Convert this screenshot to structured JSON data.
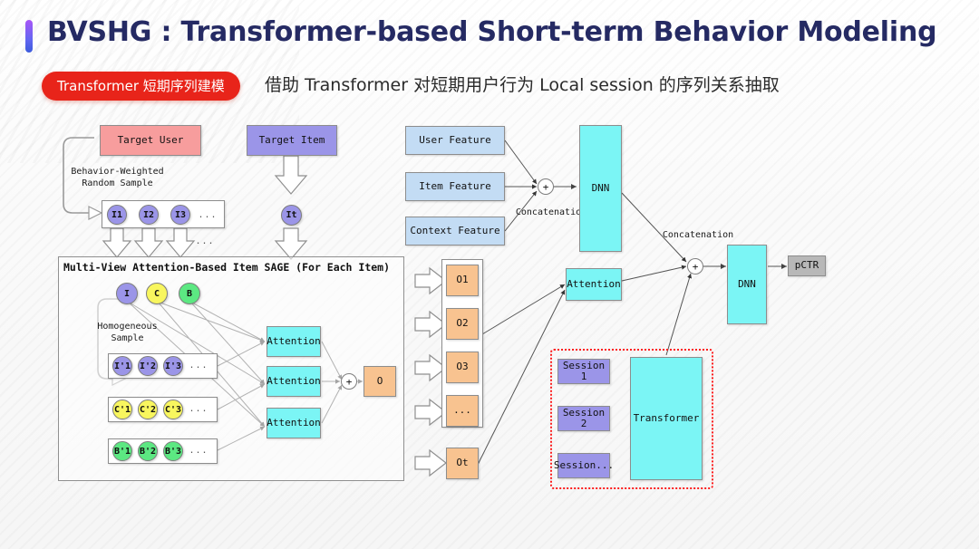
{
  "header": {
    "title": "BVSHG : Transformer-based Short-term Behavior Modeling",
    "badge": "Transformer 短期序列建模",
    "subtitle": "借助 Transformer 对短期用户行为 Local session 的序列关系抽取",
    "accent_bar_color": "#6366f1",
    "badge_color": "#e8241a",
    "title_color": "#252a63"
  },
  "diagram": {
    "target_user": "Target User",
    "target_item": "Target Item",
    "behavior_sample_label": "Behavior-Weighted\nRandom Sample",
    "homogeneous_sample_label": "Homogeneous\nSample",
    "item_seq": [
      "I1",
      "I2",
      "I3"
    ],
    "item_seq_ellipsis": "...",
    "target_item_node": "It",
    "sage_panel_title": "Multi-View Attention-Based Item SAGE (For Each Item)",
    "view_nodes": [
      {
        "label": "I",
        "color": "#9b95e8"
      },
      {
        "label": "C",
        "color": "#f8f65e"
      },
      {
        "label": "B",
        "color": "#5ce882"
      }
    ],
    "neighbor_rows": [
      {
        "nodes": [
          "I'1",
          "I'2",
          "I'3"
        ],
        "ellipsis": "...",
        "color": "#9b95e8"
      },
      {
        "nodes": [
          "C'1",
          "C'2",
          "C'3"
        ],
        "ellipsis": "...",
        "color": "#f8f65e"
      },
      {
        "nodes": [
          "B'1",
          "B'2",
          "B'3"
        ],
        "ellipsis": "...",
        "color": "#5ce882"
      }
    ],
    "sage_attentions": [
      "Attention",
      "Attention",
      "Attention"
    ],
    "sage_plus": "+",
    "sage_output": "O",
    "outputs": [
      "O1",
      "O2",
      "O3",
      "...",
      "Ot"
    ],
    "features": [
      "User Feature",
      "Item Feature",
      "Context Feature"
    ],
    "concat_left": "Concatenation",
    "concat_right": "Concatenation",
    "plus_left": "+",
    "plus_right": "+",
    "dnn_top": "DNN",
    "dnn_right": "DNN",
    "attention_mid": "Attention",
    "pctr": "pCTR",
    "sessions": [
      "Session 1",
      "Session 2",
      "Session..."
    ],
    "transformer": "Transformer",
    "highlight_border_color": "#fc1d1d"
  }
}
